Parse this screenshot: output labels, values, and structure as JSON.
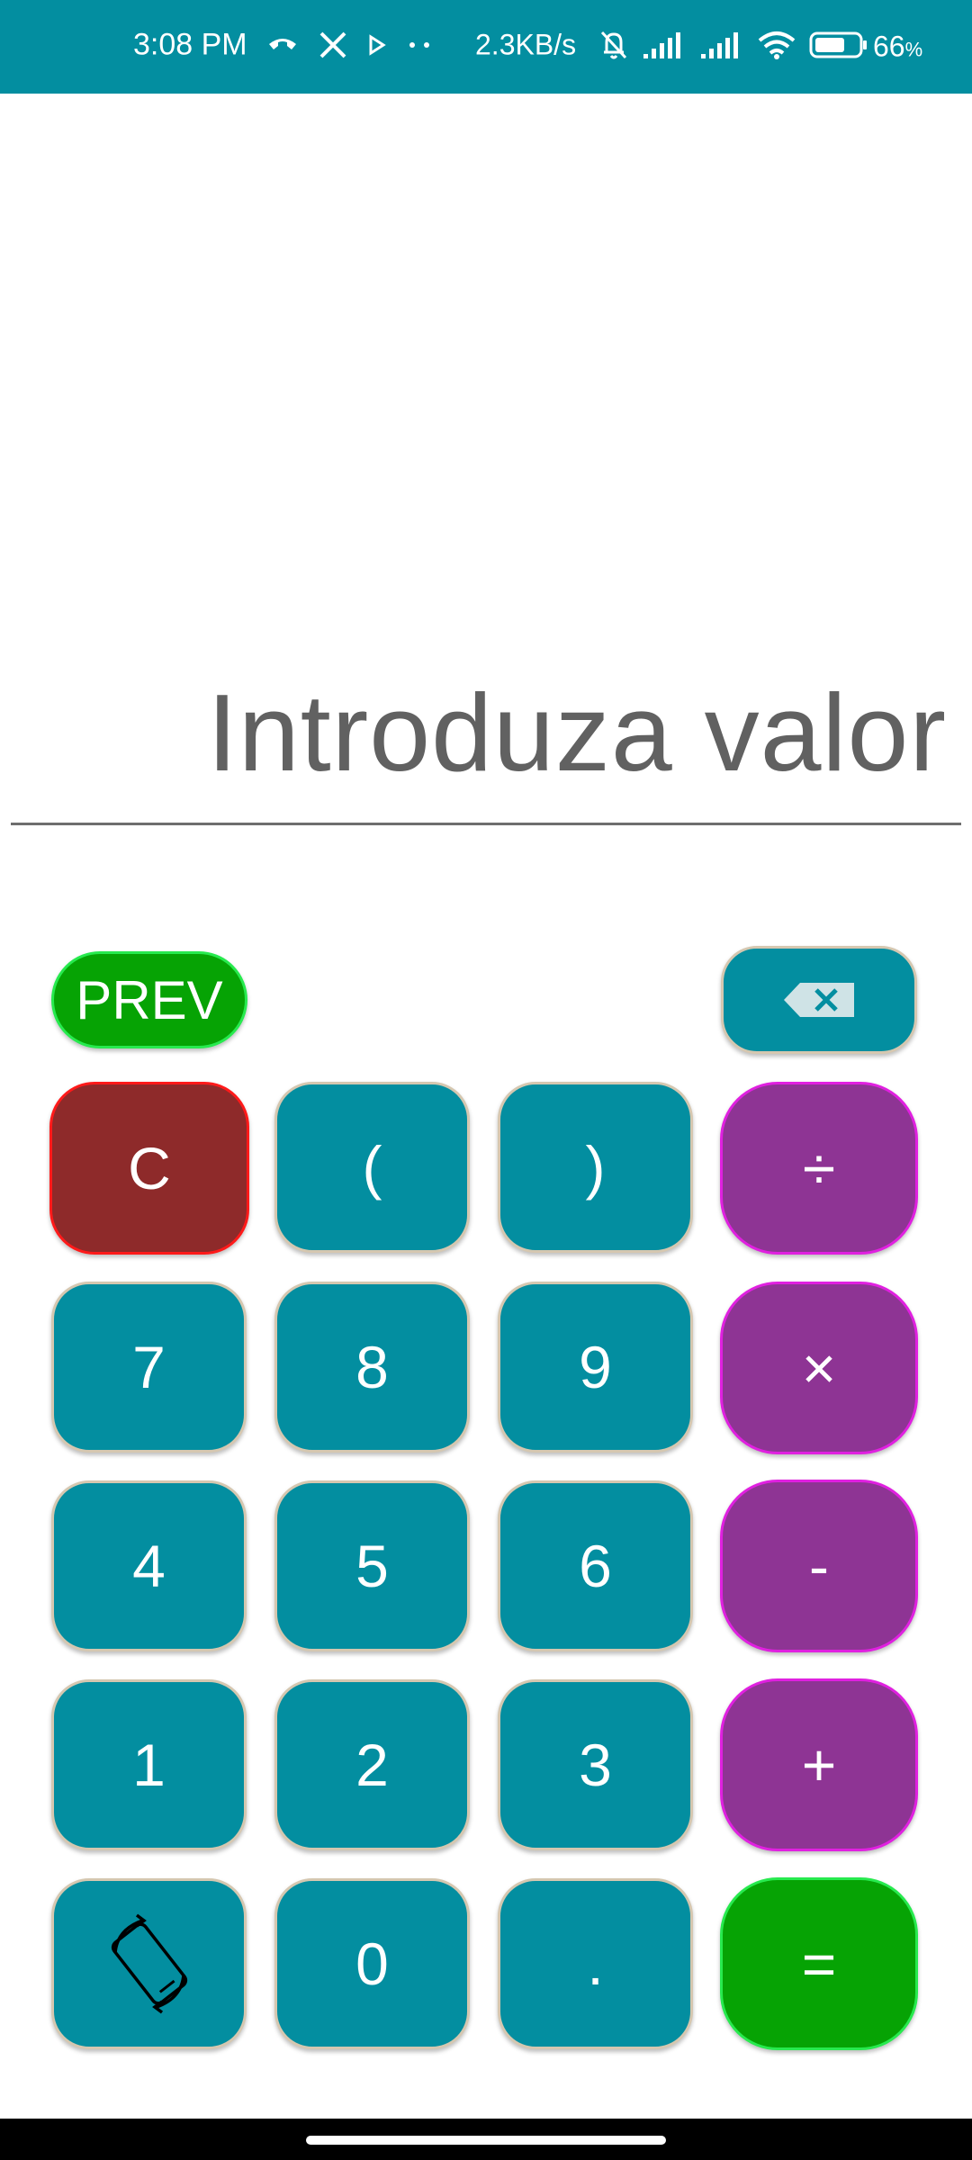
{
  "status_bar": {
    "time": "3:08 PM",
    "icons_left": [
      "call-icon",
      "x-icon",
      "play-icon",
      "dots-icon"
    ],
    "speed": "2.3KB/s",
    "icons_right": [
      "bell-off-icon",
      "signal-icon",
      "signal-icon",
      "wifi-icon",
      "battery-icon"
    ],
    "battery_percent": "66",
    "battery_unit": "%"
  },
  "display": {
    "placeholder": "Introduza valor",
    "value": ""
  },
  "keypad": {
    "prev_label": "PREV",
    "backspace_icon": "backspace-icon",
    "rows": [
      [
        "C",
        "(",
        ")",
        "÷"
      ],
      [
        "7",
        "8",
        "9",
        "×"
      ],
      [
        "4",
        "5",
        "6",
        "-"
      ],
      [
        "1",
        "2",
        "3",
        "+"
      ],
      [
        "rotate-icon",
        "0",
        ".",
        "="
      ]
    ]
  },
  "colors": {
    "teal": "#038EA0",
    "red": "#8E2A2A",
    "purple": "#8E3494",
    "green": "#06A304"
  }
}
